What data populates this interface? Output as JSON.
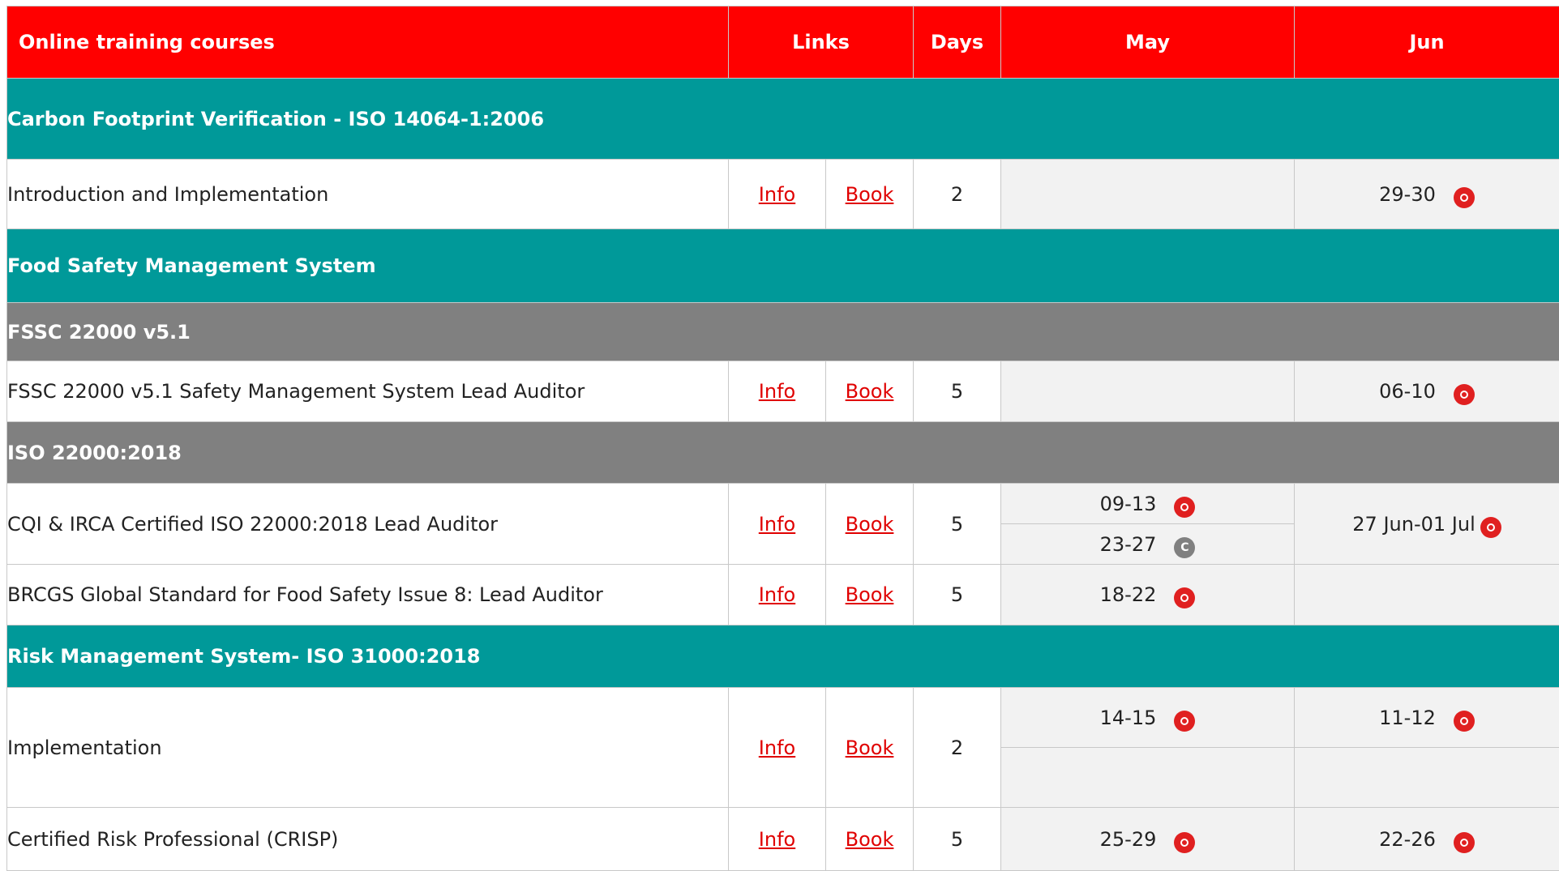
{
  "header": {
    "course_col": "Online training courses",
    "links_col": "Links",
    "days_col": "Days",
    "months": [
      "May",
      "Jun"
    ]
  },
  "link_labels": {
    "info": "Info",
    "book": "Book"
  },
  "sections": {
    "carbon": {
      "title": "Carbon Footprint Verification - ISO 14064-1:2006"
    },
    "food": {
      "title": "Food Safety Management System"
    },
    "fssc": {
      "title": "FSSC 22000 v5.1"
    },
    "iso22000": {
      "title": "ISO 22000:2018"
    },
    "risk": {
      "title": "Risk Management System- ISO 31000:2018"
    }
  },
  "courses": {
    "intro_impl": {
      "title": "Introduction and Implementation",
      "days": "2",
      "may": "",
      "jun": "29-30"
    },
    "fssc_lead": {
      "title": "FSSC 22000 v5.1 Safety Management System Lead Auditor",
      "days": "5",
      "may": "",
      "jun": "06-10"
    },
    "cqi_irca": {
      "title": "CQI & IRCA Certified ISO 22000:2018 Lead Auditor",
      "days": "5",
      "may_1": "09-13",
      "may_2": "23-27",
      "jun": "27 Jun-01 Jul"
    },
    "brcgs": {
      "title": "BRCGS Global Standard for Food Safety Issue 8: Lead Auditor",
      "days": "5",
      "may": "18-22",
      "jun": ""
    },
    "risk_impl": {
      "title": "Implementation",
      "days": "2",
      "may_1": "14-15",
      "may_2": "",
      "jun_1": "11-12",
      "jun_2": ""
    },
    "crisp": {
      "title": "Certified Risk Professional (CRISP)",
      "days": "5",
      "may": "25-29",
      "jun": "22-26"
    }
  },
  "icons": {
    "open": "open-status-icon",
    "closed": "closed-status-icon",
    "colors": {
      "open": "#e02020",
      "closed": "#808080"
    }
  },
  "colors": {
    "header_bg": "#ff0000",
    "category_bg": "#009999",
    "subcategory_bg": "#808080",
    "date_cell_bg": "#f2f2f2",
    "link_color": "#e00000"
  }
}
